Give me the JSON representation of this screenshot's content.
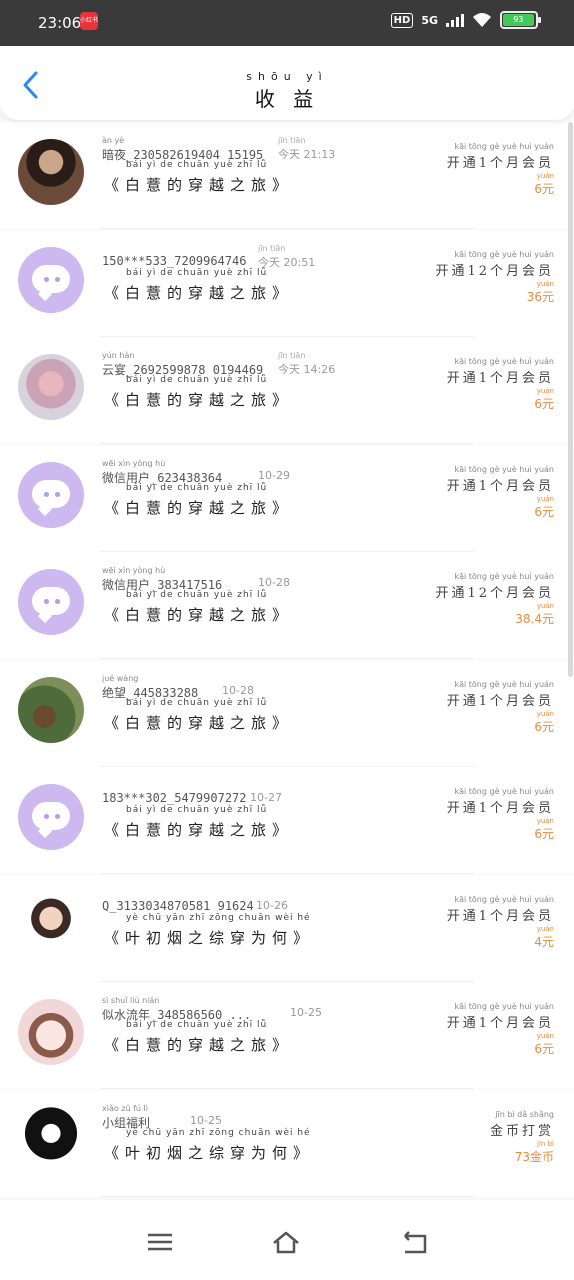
{
  "status": {
    "time": "23:06",
    "app_badge": "小红书",
    "hd": "HD",
    "network": "5G",
    "battery": "93"
  },
  "header": {
    "title_pinyin": "shōu yì",
    "title": "收 益"
  },
  "book_pinyin_a": "bái yì de chuān yuè zhī lǚ",
  "book_pinyin_b": "yè chū yān zhī zōng chuān wèi hé",
  "rows": [
    {
      "name": "暗夜_230582619404 15195",
      "name_py": "àn yè",
      "time": "今天 21:13",
      "time_py": "jīn tiān",
      "book": "《白薏的穿越之旅》",
      "book_py": "bái yì de chuān yuè zhī lǚ",
      "plan": "开通1个月会员",
      "plan_py": "kāi tōng gè yuè huì yuán",
      "amount": "6元",
      "amount_py": "yuán"
    },
    {
      "name": "150***533_7209964746",
      "name_py": "",
      "time": "今天 20:51",
      "time_py": "jīn tiān",
      "book": "《白薏的穿越之旅》",
      "book_py": "bái yì de chuān yuè zhī lǚ",
      "plan": "开通12个月会员",
      "plan_py": "kāi tōng gè yuè huì yuán",
      "amount": "36元",
      "amount_py": "yuán"
    },
    {
      "name": "云宴_2692599878 0194469",
      "name_py": "yún hàn",
      "time": "今天 14:26",
      "time_py": "jīn tiān",
      "book": "《白薏的穿越之旅》",
      "book_py": "bái yì de chuān yuè zhī lǚ",
      "plan": "开通1个月会员",
      "plan_py": "kāi tōng gè yuè huì yuán",
      "amount": "6元",
      "amount_py": "yuán"
    },
    {
      "name": "微信用户_623438364",
      "name_py": "wēi xìn yòng hù",
      "time": "10-29",
      "time_py": "",
      "book": "《白薏的穿越之旅》",
      "book_py": "bái yì de chuān yuè zhī lǚ",
      "plan": "开通1个月会员",
      "plan_py": "kāi tōng gè yuè huì yuán",
      "amount": "6元",
      "amount_py": "yuán"
    },
    {
      "name": "微信用户_383417516",
      "name_py": "wēi xìn yòng hù",
      "time": "10-28",
      "time_py": "",
      "book": "《白薏的穿越之旅》",
      "book_py": "bái yì de chuān yuè zhī lǚ",
      "plan": "开通12个月会员",
      "plan_py": "kāi tōng gè yuè huì yuán",
      "amount": "38.4元",
      "amount_py": "yuán"
    },
    {
      "name": "绝望_445833288",
      "name_py": "jué wàng",
      "time": "10-28",
      "time_py": "",
      "book": "《白薏的穿越之旅》",
      "book_py": "bái yì de chuān yuè zhī lǚ",
      "plan": "开通1个月会员",
      "plan_py": "kāi tōng gè yuè huì yuán",
      "amount": "6元",
      "amount_py": "yuán"
    },
    {
      "name": "183***302_5479907272",
      "name_py": "",
      "time": "10-27",
      "time_py": "",
      "book": "《白薏的穿越之旅》",
      "book_py": "bái yì de chuān yuè zhī lǚ",
      "plan": "开通1个月会员",
      "plan_py": "kāi tōng gè yuè huì yuán",
      "amount": "6元",
      "amount_py": "yuán"
    },
    {
      "name": "Q_3133034870581 91624",
      "name_py": "",
      "time": "10-26",
      "time_py": "",
      "book": "《叶初烟之综穿为何》",
      "book_py": "yè chū yān zhī zōng chuān wèi hé",
      "plan": "开通1个月会员",
      "plan_py": "kāi tōng gè yuè huì yuán",
      "amount": "4元",
      "amount_py": "yuán"
    },
    {
      "name": "似水流年_348586560 ...",
      "name_py": "sì shuǐ liú nián",
      "time": "10-25",
      "time_py": "",
      "book": "《白薏的穿越之旅》",
      "book_py": "bái yì de chuān yuè zhī lǚ",
      "plan": "开通1个月会员",
      "plan_py": "kāi tōng gè yuè huì yuán",
      "amount": "6元",
      "amount_py": "yuán"
    },
    {
      "name": "小组福利",
      "name_py": "xiǎo zǔ fú lì",
      "time": "10-25",
      "time_py": "",
      "book": "《叶初烟之综穿为何》",
      "book_py": "yè chū yān zhī zōng chuān wèi hé",
      "plan": "金币打赏",
      "plan_py": "jīn bì dǎ shǎng",
      "amount": "73金币",
      "amount_py": "jīn bì"
    }
  ],
  "colors": {
    "accent": "#2a8ae8",
    "amount": "#ec8a3a",
    "wx_avatar": "#cdb8ef"
  },
  "nav": {
    "menu_icon": "menu-icon",
    "home_icon": "home-icon",
    "back_icon": "back-icon"
  }
}
